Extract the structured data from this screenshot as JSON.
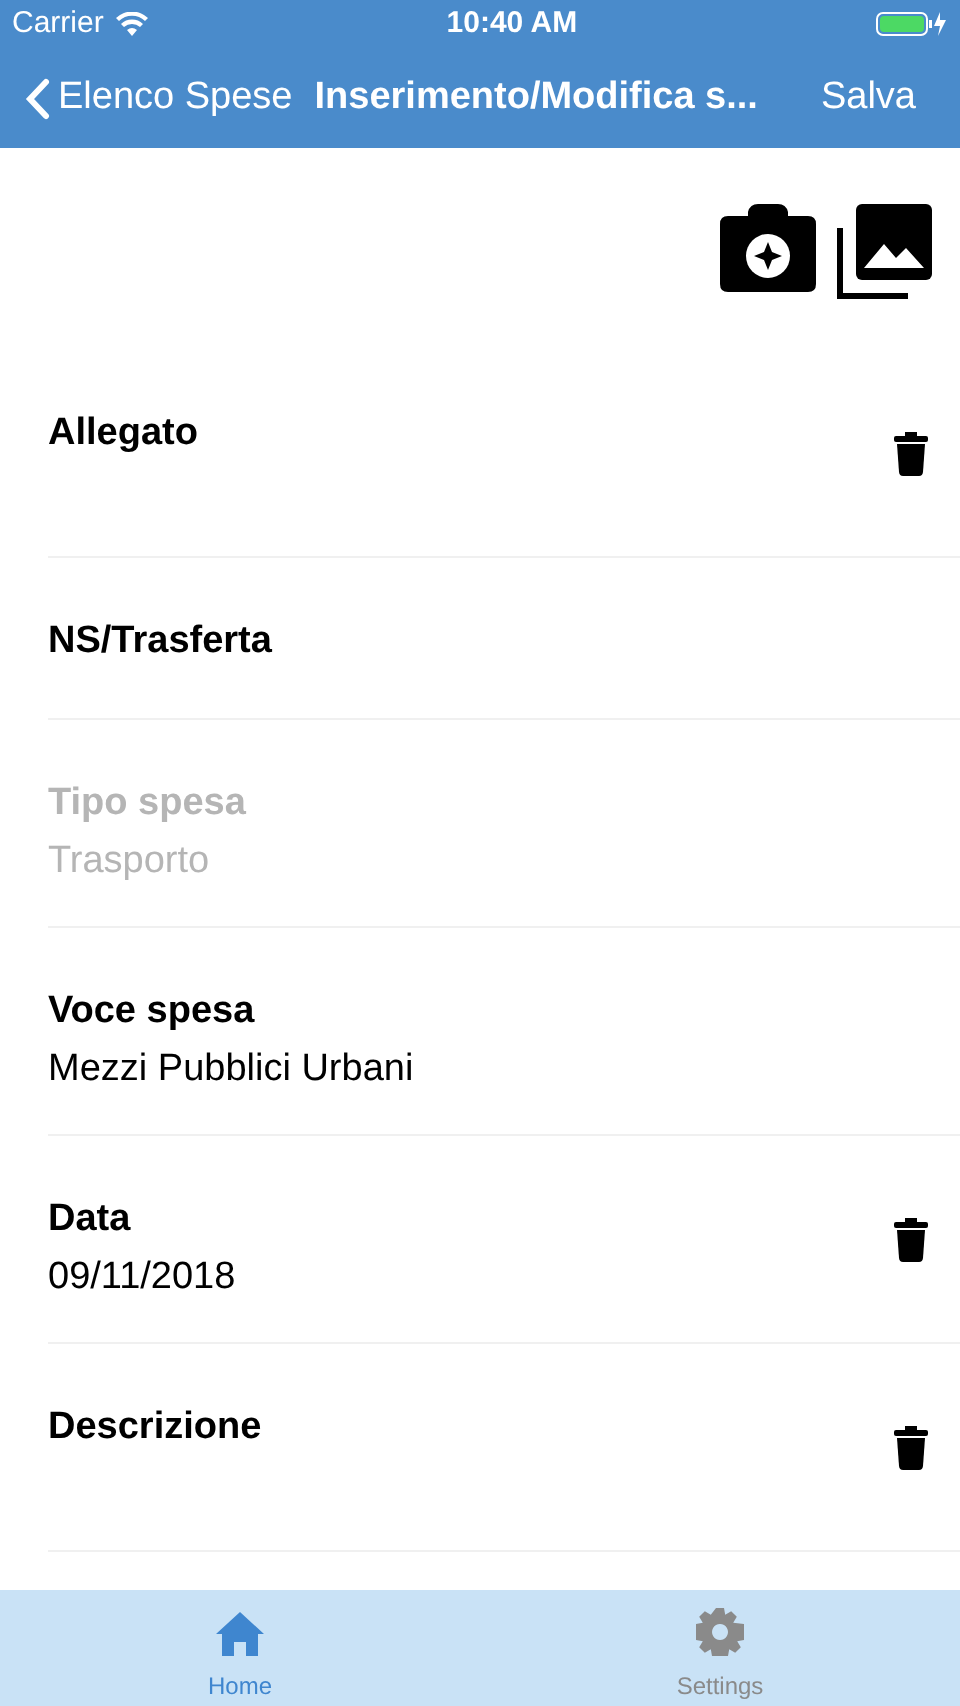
{
  "status_bar": {
    "carrier": "Carrier",
    "time": "10:40 AM"
  },
  "nav_bar": {
    "back": "Elenco Spese",
    "title": "Inserimento/Modifica s...",
    "action": "Salva"
  },
  "fields": [
    {
      "label": "Allegato",
      "disabled": false,
      "deletable": true
    },
    {
      "label": "NS/Trasferta",
      "disabled": false,
      "deletable": false
    },
    {
      "label": "Tipo spesa",
      "value": "Trasporto",
      "disabled": true,
      "deletable": false
    },
    {
      "label": "Voce spesa",
      "value": "Mezzi Pubblici Urbani",
      "disabled": false,
      "deletable": false
    },
    {
      "label": "Data",
      "value": "09/11/2018",
      "disabled": false,
      "deletable": true
    },
    {
      "label": "Descrizione",
      "disabled": false,
      "deletable": true
    }
  ],
  "tab_bar": [
    {
      "label": "Home",
      "kind": "home",
      "selected": true
    },
    {
      "label": "Settings",
      "kind": "settings",
      "selected": false
    }
  ]
}
